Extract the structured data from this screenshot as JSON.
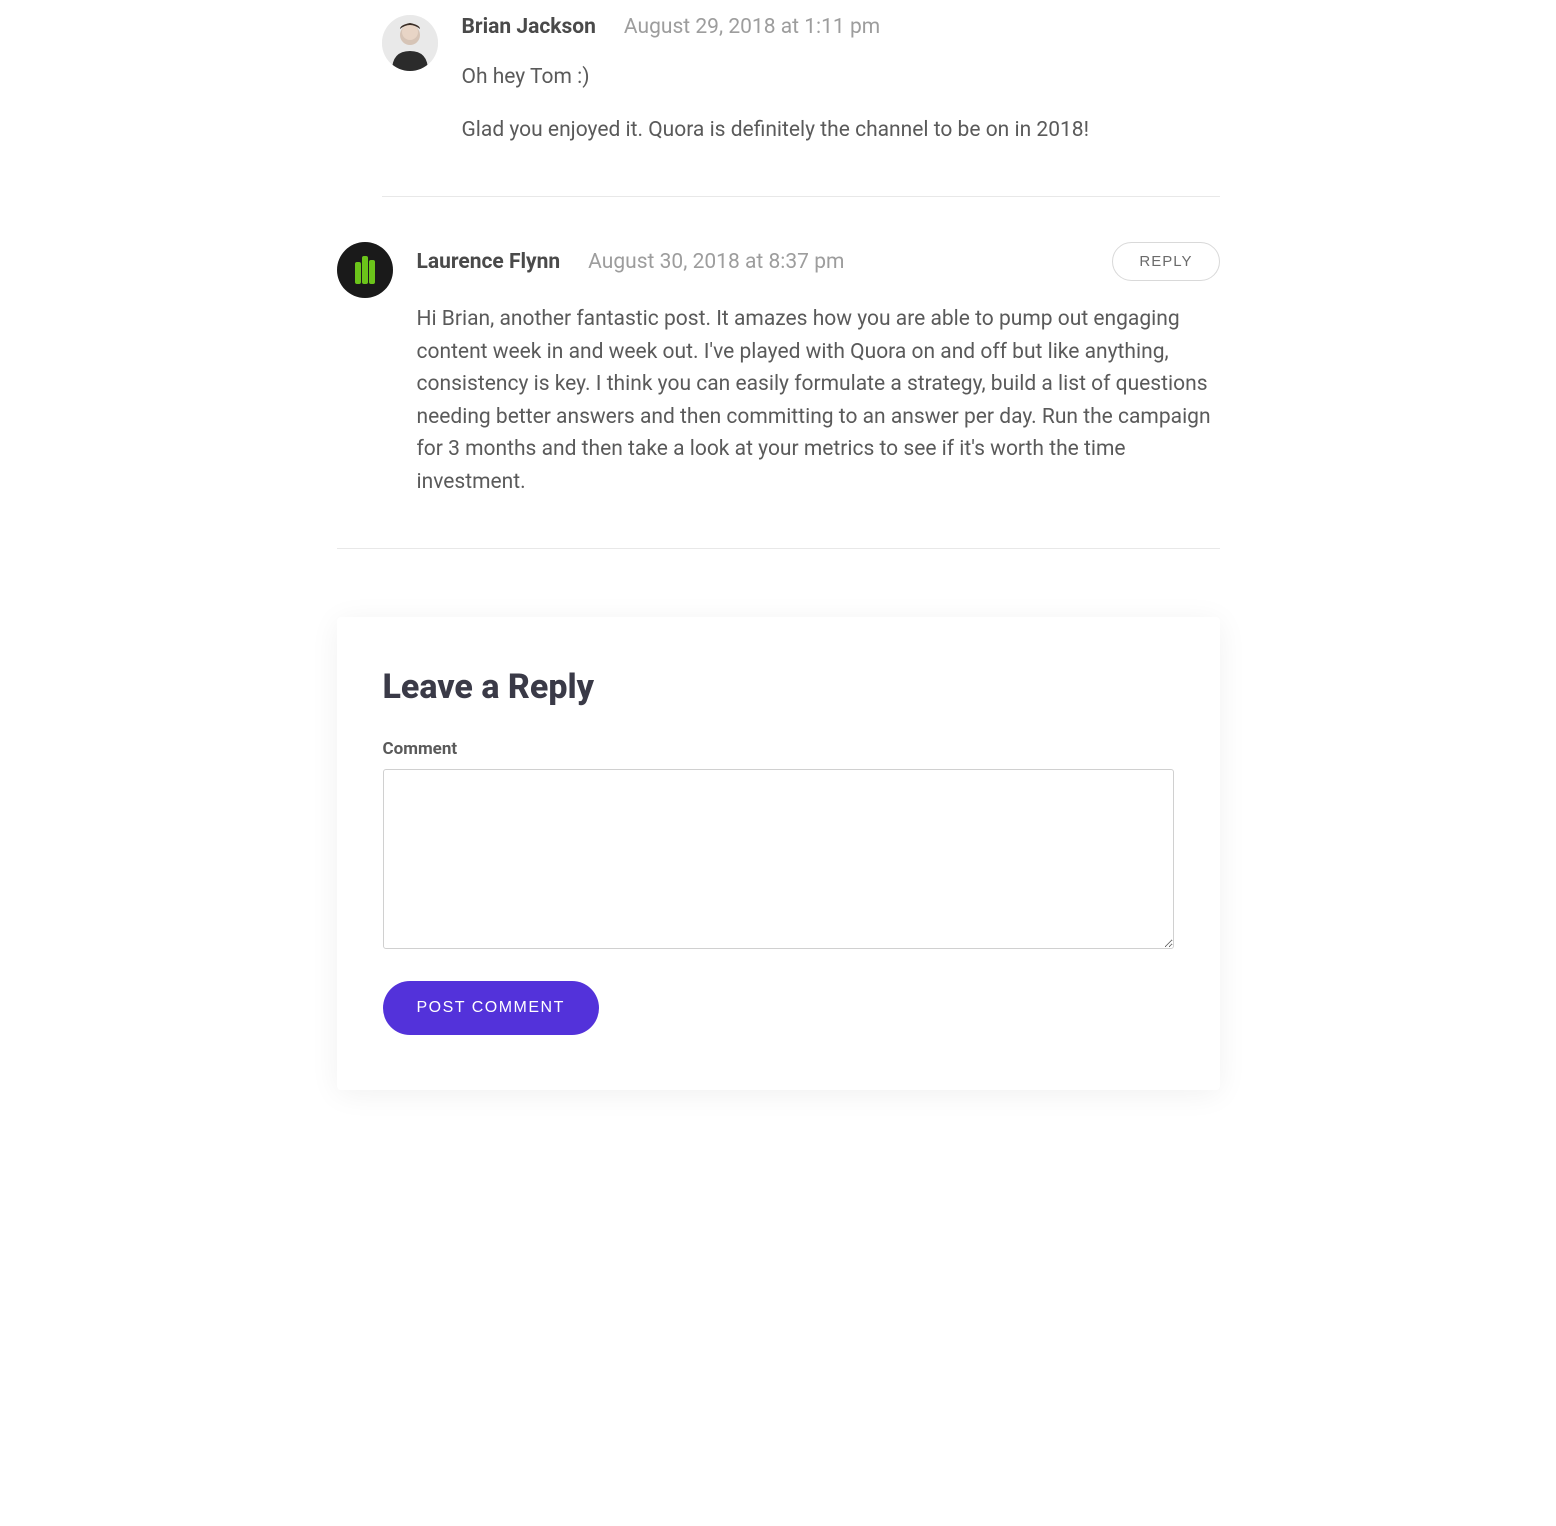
{
  "comments": [
    {
      "author": "Brian Jackson",
      "date": "August 29, 2018 at 1:11 pm",
      "paragraphs": [
        "Oh hey Tom :)",
        "Glad you enjoyed it. Quora is definitely the channel to be on in 2018!"
      ],
      "nested": true,
      "reply": false
    },
    {
      "author": "Laurence Flynn",
      "date": "August 30, 2018 at 8:37 pm",
      "paragraphs": [
        "Hi Brian, another fantastic post. It amazes how you are able to pump out engaging content week in and week out. I've played with Quora on and off but like anything, consistency is key. I think you can easily formulate a strategy, build a list of questions needing better answers and then committing to an answer per day. Run the campaign for 3 months and then take a look at your metrics to see if it's worth the time investment."
      ],
      "nested": false,
      "reply": true
    }
  ],
  "reply_label": "REPLY",
  "form": {
    "title": "Leave a Reply",
    "comment_label": "Comment",
    "submit_label": "POST COMMENT"
  }
}
